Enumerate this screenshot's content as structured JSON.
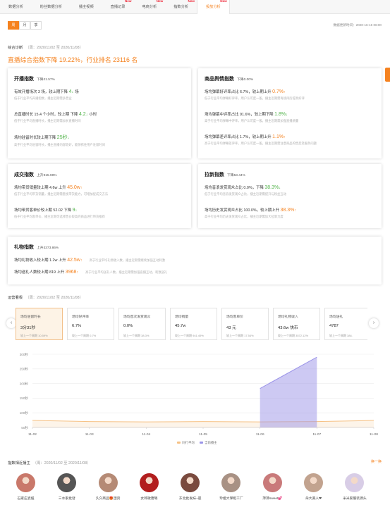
{
  "nav": {
    "tabs": [
      {
        "label": "数据分析",
        "badge": ""
      },
      {
        "label": "粉丝数据分析",
        "badge": ""
      },
      {
        "label": "播主视频",
        "badge": ""
      },
      {
        "label": "直播记录",
        "badge": "New"
      },
      {
        "label": "电商分析",
        "badge": "New"
      },
      {
        "label": "指数分析",
        "badge": "New"
      },
      {
        "label": "投放分析",
        "badge": "New"
      }
    ],
    "active_index": 6
  },
  "period_tabs": [
    "周",
    "月",
    "季"
  ],
  "update_time": "数据更新时间：2020-16-16 06:00",
  "diagnosis": {
    "title": "综合诊断",
    "range": "（周：2020/11/02 至 2020/11/08）",
    "headline": "直播综合指数下降 19.22%，行业排名 23116 名"
  },
  "cards": {
    "broadcast": {
      "title": "开播指数",
      "trend": "下降21.57%",
      "rows": [
        {
          "main": "有效开播场次 3 场，较上期下降 ",
          "value": "4",
          "arrow": "↓",
          "unit": "场",
          "dir": "dn",
          "sub": "低于行业平均开播指数，播主近期需多营业"
        },
        {
          "main": "总直播时长 15.4 个小时，较上期 下降 ",
          "value": "4.2",
          "arrow": "↓",
          "unit": "小时",
          "dir": "dn",
          "sub": "低于行业平均直播时长，播主近期需加长直播时间"
        },
        {
          "main": "场均驻留时长较上期下降 ",
          "value": "25秒",
          "arrow": "↓",
          "unit": "",
          "dir": "dn",
          "sub": "高于行业平均驻留时长，播主直播内容较好，能够抓住用户驻留时间"
        }
      ]
    },
    "sentiment": {
      "title": "商品舆情指数",
      "trend": "下降0.00%",
      "rows": [
        {
          "main": "场均弹幕好评率占比 6.7%，较上期上升 ",
          "value": "0.7%",
          "arrow": "↑",
          "unit": "",
          "dir": "up",
          "sub": "低于行业平均弹幕好评率，用户认可度一般，播主近期需再接再厉提高好评"
        },
        {
          "main": "场均弹幕中评率占比 91.6%，较上期下降 ",
          "value": "1.8%",
          "arrow": "↓",
          "unit": "",
          "dir": "dn",
          "sub": "高于行业平均弹幕中评率，用户认可度一般，播主近期需加强直播质量"
        },
        {
          "main": "场均弹幕差评率占比 1.7%，较上期上升 ",
          "value": "1.1%",
          "arrow": "↑",
          "unit": "",
          "dir": "up",
          "sub": "高于行业平均弹幕差评率，用户认可度一般，播主近期需注意商品的售后及服务问题"
        }
      ]
    },
    "deal": {
      "title": "成交指数",
      "trend": "上升915.98%",
      "rows": [
        {
          "main": "场均带货销量较上期 4.6w 上升 ",
          "value": "45.0w",
          "arrow": "↑",
          "unit": "",
          "dir": "up",
          "sub": "低于行业平均带货销量，播主近期需重视带货能力，可增加促成交方法"
        },
        {
          "main": "场均带货客单价较上期 52.02 下降 ",
          "value": "9",
          "arrow": "↓",
          "unit": "",
          "dir": "dn",
          "sub": "低于行业平均客单价，播主近期可选择售价较高的商品进行带货推荐"
        }
      ]
    },
    "traffic": {
      "title": "拉新指数",
      "trend": "下降53.44%",
      "rows": [
        {
          "main": "场均音浪发赏观众占比 0.0%，下降 ",
          "value": "38.3%",
          "arrow": "↓",
          "unit": "",
          "dir": "dn",
          "sub": "低于行业平均音浪发赏观众占比，播主近期需提升与粉丝互动"
        },
        {
          "main": "场均历史发赏观众占比 100.0%，较上期上升 ",
          "value": "38.3%",
          "arrow": "↑",
          "unit": "",
          "dir": "up",
          "sub": "高于行业平均历史发赏观众占比，播主近期需加大拉新力度"
        }
      ]
    },
    "gift": {
      "title": "礼物指数",
      "trend": "上升3373.86%",
      "rows": [
        {
          "main": "场均礼物收入较上期 1.2w 上升 ",
          "value": "42.5w",
          "arrow": "↑",
          "unit": "",
          "dir": "up",
          "sub": "高于行业平均礼物收入数，播主近期需继续加强互动刺激"
        },
        {
          "main": "场均送礼人数较上期 819 上升 ",
          "value": "3968",
          "arrow": "↑",
          "unit": "",
          "dir": "up",
          "sub": "高于行业平均送礼人数，播主近期需加强直播互动，刺激送礼"
        }
      ]
    }
  },
  "operations": {
    "title": "运营看板",
    "range": "（周：2020/11/02 至 2020/11/08）",
    "metrics": [
      {
        "label": "场均驻留时长",
        "value": "3分31秒",
        "compare": "较上一个周期 10.59%",
        "active": true
      },
      {
        "label": "场均好评率",
        "value": "6.7%",
        "compare": "较上一个周期 0.7%",
        "active": false
      },
      {
        "label": "场均首次发赏观众",
        "value": "0.0%",
        "compare": "较上一个周期 38.3%",
        "active": false
      },
      {
        "label": "场均销量",
        "value": "45.7w",
        "compare": "较上一个周期 941.49%",
        "active": false
      },
      {
        "label": "场均客单价",
        "value": "43 元",
        "compare": "较上一个周期 17.54%",
        "active": false
      },
      {
        "label": "场均礼物收入",
        "value": "43.6w 快币",
        "compare": "较上一个周期 3572.12%",
        "active": false
      },
      {
        "label": "场均送礼",
        "value": "4787",
        "compare": "较上一个周期 384.",
        "active": false
      }
    ],
    "prev_icon": "chevron-left-icon",
    "next_icon": "chevron-right-icon"
  },
  "chart_data": {
    "type": "area",
    "x": [
      "11-02",
      "11-03",
      "11-04",
      "11-05",
      "11-06",
      "11-07",
      "11-08"
    ],
    "yticks": [
      "300秒",
      "250秒",
      "200秒",
      "150秒",
      "100秒",
      "50秒"
    ],
    "ylim": [
      50,
      300
    ],
    "grid": true,
    "legend_position": "bottom",
    "series": [
      {
        "name": "同行平均",
        "color": "#f6c184",
        "points": [
          [
            0,
            74
          ],
          [
            1,
            70
          ],
          [
            2,
            69
          ],
          [
            3,
            70
          ],
          [
            4,
            69
          ],
          [
            5,
            70
          ],
          [
            6,
            74
          ]
        ]
      },
      {
        "name": "当前播主",
        "color": "#9b94e8",
        "points": [
          [
            4,
            183
          ],
          [
            5,
            290
          ]
        ]
      }
    ]
  },
  "hosts_section": {
    "title": "指数相近播主",
    "range": "（周：2020/11/02 至 2020/11/08）",
    "more": "换一换",
    "hosts": [
      {
        "name": "石家庄瓷妞",
        "color": "#c9786a"
      },
      {
        "name": "三水家批發",
        "color": "#555555"
      },
      {
        "name": "久久商品🎁团货",
        "color": "#b58a75"
      },
      {
        "name": "女郎歌唐璐",
        "color": "#b21e1e"
      },
      {
        "name": "东北批发妹~晨",
        "color": "#7a4a3e"
      },
      {
        "name": "玲姐大掌柜工厂",
        "color": "#a89184"
      },
      {
        "name": "萍萍sweet💕",
        "color": "#c97a7a"
      },
      {
        "name": "朵大美人❤",
        "color": "#c2a38f"
      },
      {
        "name": "米米家服装源头",
        "color": "#d8cde6"
      }
    ]
  }
}
